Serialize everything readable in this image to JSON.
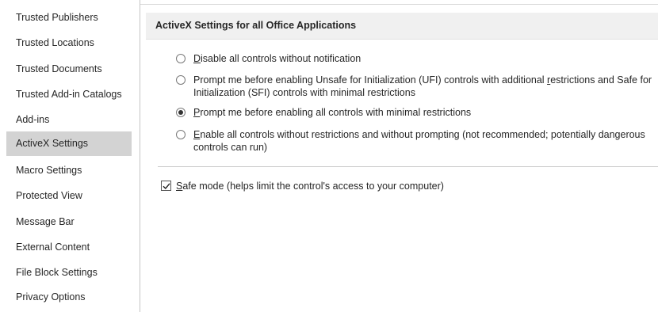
{
  "sidebar": {
    "items": [
      {
        "label": "Trusted Publishers"
      },
      {
        "label": "Trusted Locations"
      },
      {
        "label": "Trusted Documents"
      },
      {
        "label": "Trusted Add-in Catalogs"
      },
      {
        "label": "Add-ins"
      },
      {
        "label": "ActiveX Settings",
        "selected": true
      },
      {
        "label": "Macro Settings"
      },
      {
        "label": "Protected View"
      },
      {
        "label": "Message Bar"
      },
      {
        "label": "External Content"
      },
      {
        "label": "File Block Settings"
      },
      {
        "label": "Privacy Options"
      }
    ]
  },
  "main": {
    "section_title": "ActiveX Settings for all Office Applications",
    "options": [
      {
        "accel": "D",
        "rest": "isable all controls without notification",
        "line2": "",
        "checked": false
      },
      {
        "line1_pre": "Prompt me before enabling Unsafe for Initialization (UFI) controls with additional ",
        "line1_accel": "r",
        "line1_post": "estrictions and Safe for",
        "line2": "Initialization (SFI) controls with minimal restrictions",
        "checked": false
      },
      {
        "accel": "P",
        "rest": "rompt me before enabling all controls with minimal restrictions",
        "line2": "",
        "checked": true
      },
      {
        "accel": "E",
        "rest": "nable all controls without restrictions and without prompting (not recommended; potentially dangerous",
        "line2": "controls can run)",
        "checked": false
      }
    ],
    "safe_mode": {
      "accel": "S",
      "rest": "afe mode (helps limit the control's access to your computer)",
      "checked": true
    }
  },
  "colors": {
    "selected_bg": "#d3d3d3",
    "header_bg": "#f0f0f0",
    "text": "#262626"
  }
}
